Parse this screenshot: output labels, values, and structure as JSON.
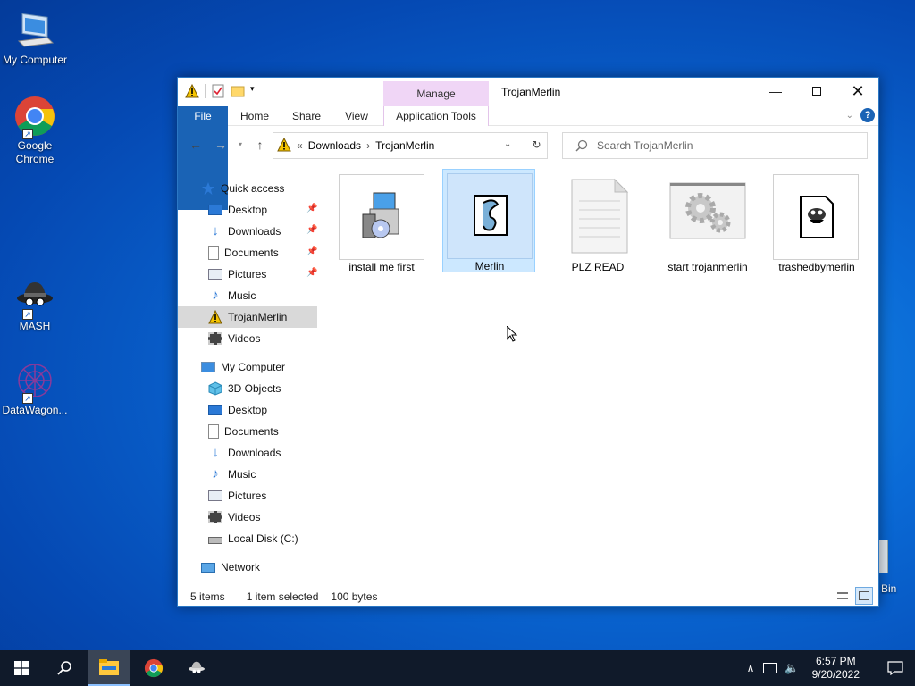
{
  "desktop": {
    "icons": [
      {
        "label": "My Computer"
      },
      {
        "label": "Google Chrome"
      },
      {
        "label": "MASH"
      },
      {
        "label": "DataWagon..."
      }
    ],
    "recycle_label": "Bin"
  },
  "window": {
    "title": "TrojanMerlin",
    "context_tab": "Manage",
    "ribbon_tabs": [
      "File",
      "Home",
      "Share",
      "View",
      "Application Tools"
    ],
    "address": {
      "prefix": "«",
      "crumbs": [
        "Downloads",
        "TrojanMerlin"
      ]
    },
    "search_placeholder": "Search TrojanMerlin",
    "nav": {
      "quick_access": "Quick access",
      "quick_items": [
        "Desktop",
        "Downloads",
        "Documents",
        "Pictures",
        "Music",
        "TrojanMerlin",
        "Videos"
      ],
      "my_computer": "My Computer",
      "pc_items": [
        "3D Objects",
        "Desktop",
        "Documents",
        "Downloads",
        "Music",
        "Pictures",
        "Videos",
        "Local Disk (C:)"
      ],
      "network": "Network"
    },
    "files": [
      {
        "name": "install me first",
        "icon": "installer-icon"
      },
      {
        "name": "Merlin",
        "icon": "script-icon"
      },
      {
        "name": "PLZ READ",
        "icon": "text-document-icon"
      },
      {
        "name": "start trojanmerlin",
        "icon": "gears-icon"
      },
      {
        "name": "trashedbymerlin",
        "icon": "creature-document-icon"
      }
    ],
    "status": {
      "count": "5 items",
      "selection": "1 item selected",
      "size": "100 bytes"
    }
  },
  "taskbar": {
    "time": "6:57 PM",
    "date": "9/20/2022"
  },
  "colors": {
    "accent": "#1a63b5",
    "selection": "#cce8ff",
    "manage": "#f0d6f6"
  }
}
